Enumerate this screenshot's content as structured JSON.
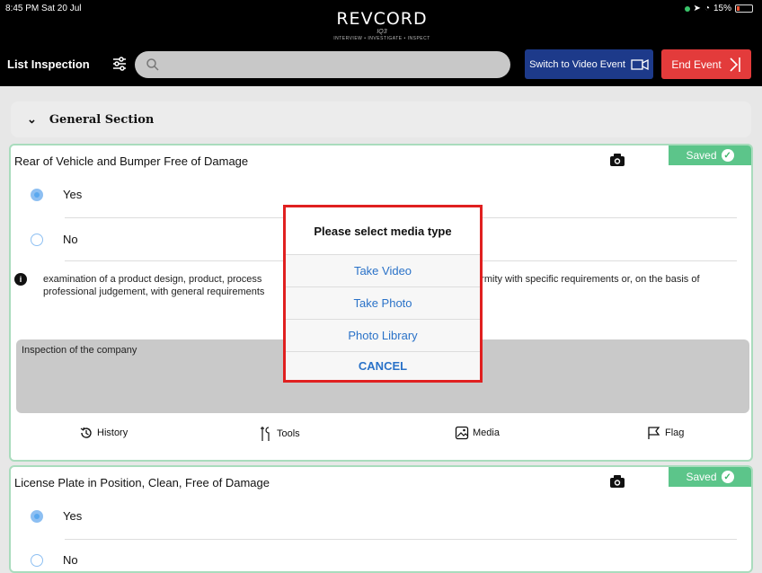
{
  "status": {
    "time": "8:45 PM  Sat 20 Jul",
    "battery": "15%"
  },
  "logo": {
    "name": "REVCORD",
    "script": "IQ3",
    "tagline": "INTERVIEW • INVESTIGATE • INSPECT"
  },
  "header": {
    "title": "List Inspection",
    "search_placeholder": "",
    "video_button": "Switch to Video Event",
    "end_button": "End Event"
  },
  "section": {
    "title": "General Section"
  },
  "cards": [
    {
      "title": "Rear of Vehicle and Bumper Free of Damage",
      "saved": "Saved",
      "options": [
        {
          "label": "Yes",
          "checked": true
        },
        {
          "label": "No",
          "checked": false
        }
      ],
      "description_left": "examination of a product design, product, process",
      "description_left2": "professional judgement, with general requirements",
      "description_right": "formity with specific requirements or, on the basis of",
      "notes": "Inspection of the company",
      "actions": {
        "history": "History",
        "tools": "Tools",
        "media": "Media",
        "flag": "Flag"
      }
    },
    {
      "title": "License Plate in Position, Clean, Free of Damage",
      "saved": "Saved",
      "options": [
        {
          "label": "Yes",
          "checked": true
        },
        {
          "label": "No",
          "checked": false
        }
      ]
    }
  ],
  "modal": {
    "title": "Please select media type",
    "items": [
      "Take Video",
      "Take Photo",
      "Photo Library"
    ],
    "cancel": "CANCEL"
  },
  "colors": {
    "accent_blue": "#1d3a8a",
    "end_red": "#e33b3b",
    "saved_green": "#5cc58a",
    "highlight_red": "#e02020"
  }
}
